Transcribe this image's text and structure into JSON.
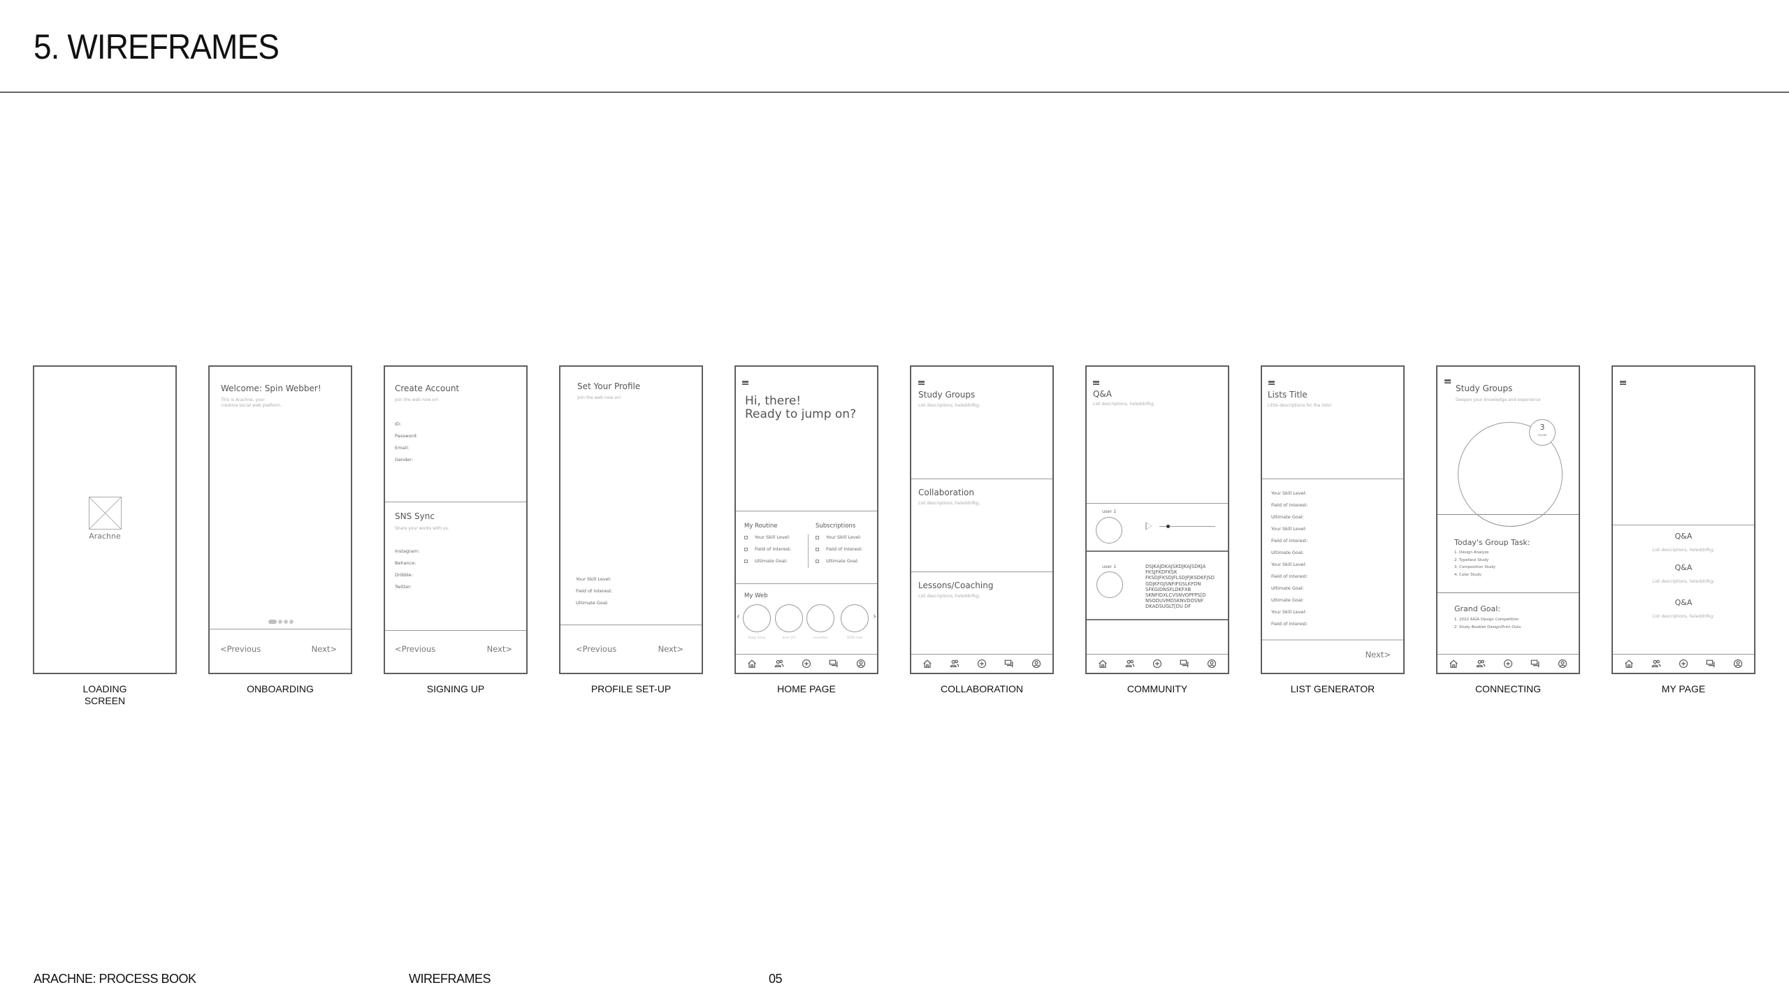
{
  "page": {
    "title": "5. WIREFRAMES",
    "footer": {
      "book": "ARACHNE: PROCESS BOOK",
      "section": "WIREFRAMES",
      "page_number": "05"
    }
  },
  "bottom_nav_icons": [
    "home-icon",
    "people-icon",
    "add-circle-icon",
    "chat-icon",
    "profile-icon"
  ],
  "frames": {
    "loading": {
      "caption_line1": "LOADING",
      "caption_line2": "SCREEN",
      "logo_placeholder": "image-placeholder-icon",
      "app_name": "Arachne"
    },
    "onboarding": {
      "caption": "ONBOARDING",
      "title": "Welcome: Spin Webber!",
      "subtitle_line1": "This is Arachne, your",
      "subtitle_line2": "creative social web platform.",
      "pagination": {
        "total": 4,
        "active": 1
      },
      "previous": "<Previous",
      "next": "Next>"
    },
    "signing_up": {
      "caption": "SIGNING UP",
      "account_title": "Create Account",
      "account_subtitle": "Join the web now on!",
      "account_fields": [
        "ID:",
        "Password:",
        "Email:",
        "Gender:"
      ],
      "sns_title": "SNS Sync",
      "sns_subtitle": "Share your works with us.",
      "sns_fields": [
        "Instagram:",
        "Behance:",
        "Dribble:",
        "Twitter:"
      ],
      "previous": "<Previous",
      "next": "Next>"
    },
    "profile_setup": {
      "caption": "PROFILE SET-UP",
      "title": "Set Your Profile",
      "subtitle": "Join the web now on!",
      "fields": [
        "Your Skill Level:",
        "Field of Interest:",
        "Ultimate Goal:"
      ],
      "previous": "<Previous",
      "next": "Next>"
    },
    "home": {
      "caption": "HOME PAGE",
      "greeting_line1": "Hi, there!",
      "greeting_line2": "Ready to jump on?",
      "routine_title": "My Routine",
      "routine_items": [
        "Your Skill Level:",
        "Field of Interest:",
        "Ultimate Goal:"
      ],
      "subscriptions_title": "Subscriptions",
      "subscription_items": [
        "Your Skill Level:",
        "Field of Interest:",
        "Ultimate Goal:"
      ],
      "web_title": "My Web",
      "web_items": [
        "Study Group",
        "desn 101",
        "inspiration",
        "DESN crew"
      ],
      "prev_arrow": "‹",
      "next_arrow": "›"
    },
    "collaboration": {
      "caption": "COLLABORATION",
      "sections": [
        {
          "title": "Study Groups",
          "description": "List descriptions, heleddnfkg;"
        },
        {
          "title": "Collaboration",
          "description": "List descriptions, heleddnfkg;"
        },
        {
          "title": "Lessons/Coaching",
          "description": "List descriptions, heleddnfkg;"
        }
      ]
    },
    "community": {
      "caption": "COMMUNITY",
      "title": "Q&A",
      "description": "List descriptions, heleddnfkg;",
      "posts": [
        {
          "user": "user 1",
          "type": "audio",
          "audio_progress": 0.15
        },
        {
          "user": "user 1",
          "type": "text",
          "text": "DSJKAJDKAJSKDJKAJSDKJA\nFKSJFKDFKSK\nFKSDJFKSDJFLSDJFJKSDKFJSD\nGDJKFGJSNFIFGSLKFDN\nSFKGIDNSFLDKFXB\nSKNFIDXLCVSNVOPFPS[D\nNSODUVMDSKNVDOSNF\nDKADSUGLT[DU DF"
        }
      ]
    },
    "list_generator": {
      "caption": "LIST GENERATOR",
      "title": "Lists Title",
      "description": "Little descriptions for the lists!",
      "fields": [
        "Your Skill Level:",
        "Field of Interest:",
        "Ultimate Goal:",
        "Your Skill Level:",
        "Field of Interest:",
        "Ultimate Goal:",
        "Your Skill Level:",
        "Field of Interest:",
        "Ultimate Goal:",
        "Ultimate Goal:",
        "Your Skill Level:",
        "Field of Interest:"
      ],
      "next": "Next>"
    },
    "connecting": {
      "caption": "CONNECTING",
      "title": "Study Groups",
      "subtitle": "Deepen your knowledge and experience",
      "online_count": "3",
      "online_label": "ONLINE",
      "task_title": "Today's Group Task:",
      "tasks": [
        "1. Design Analyze",
        "2. Typeface Study",
        "3. Composition Study",
        "4. Color Study"
      ],
      "goal_title": "Grand Goal:",
      "goals": [
        "1. 2022 AIGA Design Competition",
        "2. Study Booklet Design/Print Outs"
      ]
    },
    "my_page": {
      "caption": "MY PAGE",
      "items": [
        {
          "title": "Q&A",
          "description": "List descriptions, heleddnfkg;"
        },
        {
          "title": "Q&A",
          "description": "List descriptions, heleddnfkg;"
        },
        {
          "title": "Q&A",
          "description": "List descriptions, heleddnfkg;"
        }
      ]
    }
  }
}
